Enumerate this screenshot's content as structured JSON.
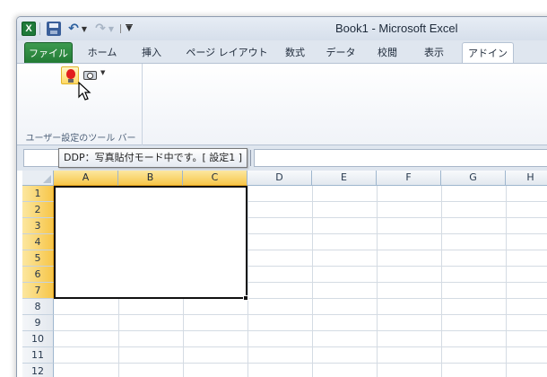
{
  "window": {
    "title": "Book1 - Microsoft Excel"
  },
  "qat": {
    "app_icon": "excel-logo-icon",
    "app_letter": "X",
    "save_icon": "save-icon",
    "undo_icon": "undo-icon",
    "redo_icon": "redo-icon"
  },
  "tabs": [
    {
      "label": "ファイル"
    },
    {
      "label": "ホーム"
    },
    {
      "label": "挿入"
    },
    {
      "label": "ページ レイアウト"
    },
    {
      "label": "数式"
    },
    {
      "label": "データ"
    },
    {
      "label": "校閲"
    },
    {
      "label": "表示"
    },
    {
      "label": "アドイン"
    }
  ],
  "active_tab": "アドイン",
  "ribbon": {
    "group_label": "ユーザー設定のツール バー",
    "buttons": [
      {
        "icon": "lightbulb-icon"
      },
      {
        "icon": "camera-icon"
      }
    ]
  },
  "tooltip": "DDP：写真貼付モード中です。[ 設定1 ]",
  "sheet": {
    "columns": [
      "A",
      "B",
      "C",
      "D",
      "E",
      "F",
      "G",
      "H"
    ],
    "rows": [
      "1",
      "2",
      "3",
      "4",
      "5",
      "6",
      "7",
      "8",
      "9",
      "10",
      "11",
      "12"
    ],
    "selected_range": "A1:C7"
  },
  "colors": {
    "file_tab": "#217a34",
    "selection_header": "#f7c649",
    "bulb": "#e21d1d"
  }
}
